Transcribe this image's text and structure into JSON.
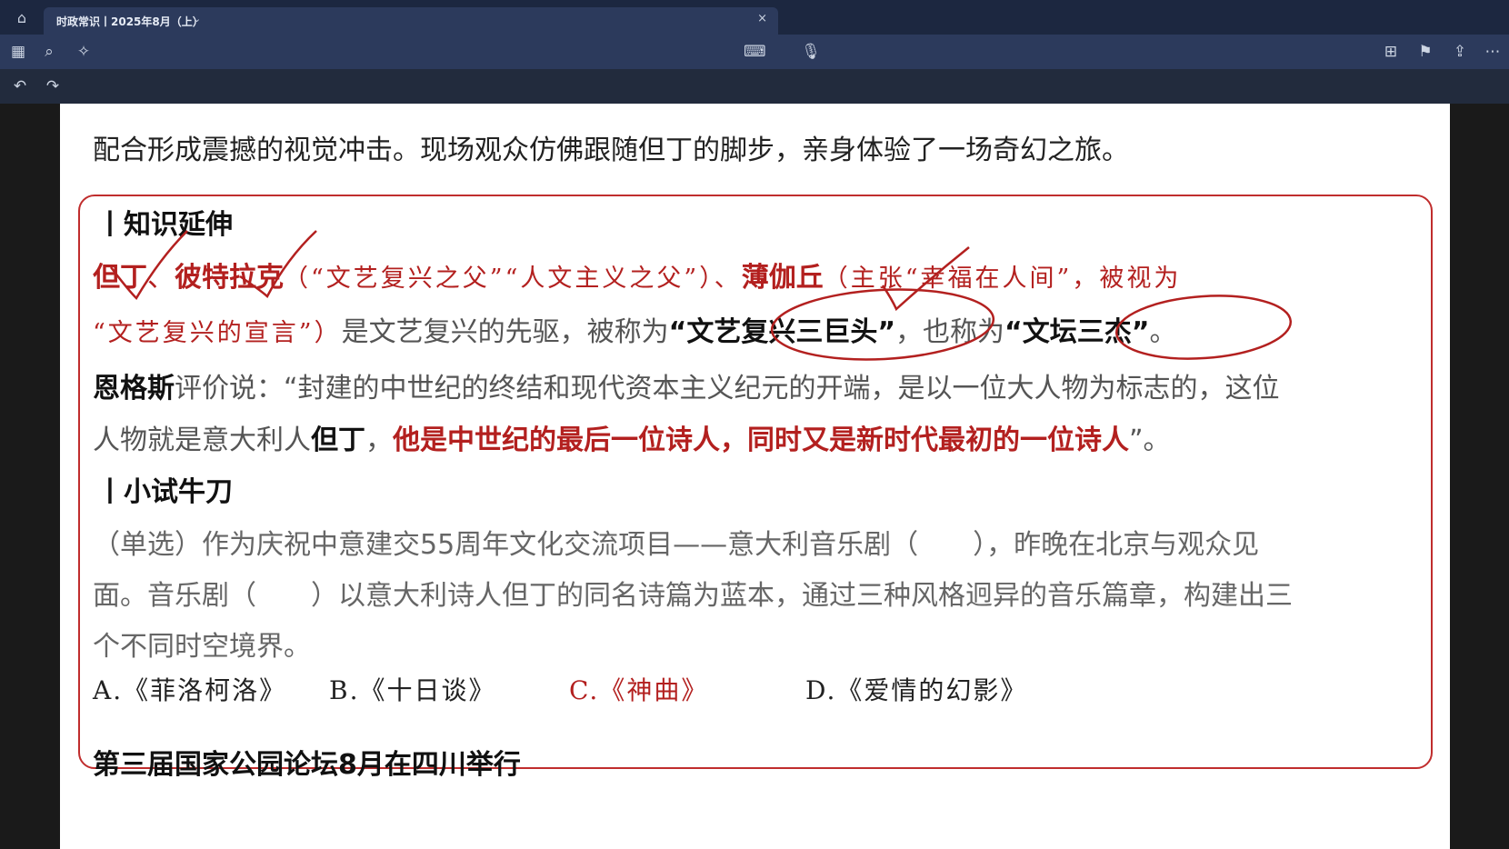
{
  "tab": {
    "title": "时政常识丨2025年8月（上）"
  },
  "page": {
    "top_line_fragment": "配合形成震撼的视觉冲击。现场观众仿佛跟随但丁的脚步，亲身体验了一场奇幻之旅。",
    "section1": {
      "heading": "丨知识延伸",
      "l1_name1": "但丁",
      "l1_sep1": "、",
      "l1_name2": "彼特拉克",
      "l1_paren": "（“文艺复兴之父”“人文主义之父”）、",
      "l1_name3": "薄伽丘",
      "l1_tail": "（主张“幸福在人间”，被视为",
      "l2_quote": "“文艺复兴的宣言”）",
      "l2_mid": "是文艺复兴的先驱，被称为",
      "l2_b1": "“文艺复兴三巨头”",
      "l2_mid2": "，也称为",
      "l2_b2": "“文坛三杰”",
      "l2_end": "。",
      "l3_name": "恩格斯",
      "l3_text": "评价说：“封建的中世纪的终结和现代资本主义纪元的开端，是以一位大人物为标志的，这位",
      "l4_a": "人物就是意大利人",
      "l4_b": "但丁",
      "l4_c": "，",
      "l4_red": "他是中世纪的最后一位诗人，同时又是新时代最初的一位诗人",
      "l4_end": "”。"
    },
    "section2": {
      "heading": "丨小试牛刀",
      "q1": "（单选）作为庆祝中意建交55周年文化交流项目——意大利音乐剧（　　），昨晚在北京与观众见",
      "q2": "面。音乐剧（　　）以意大利诗人但丁的同名诗篇为蓝本，通过三种风格迥异的音乐篇章，构建出三",
      "q3": "个不同时空境界。",
      "options": [
        "A.《菲洛柯洛》",
        "B.《十日谈》",
        "C.《神曲》",
        "D.《爱情的幻影》"
      ]
    },
    "next_heading": "第三届国家公园论坛8月在四川举行"
  },
  "colors": {
    "red": "#b3201f",
    "accent_blue": "#2b7bff"
  }
}
